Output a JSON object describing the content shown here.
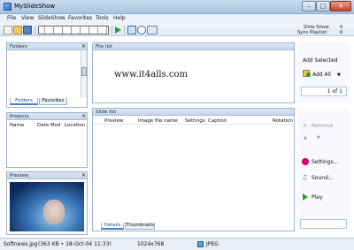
{
  "window": {
    "title": "MySlideShow"
  },
  "menu": [
    "File",
    "View",
    "SlideShow",
    "Favorites",
    "Tools",
    "Help"
  ],
  "toolbar_status": {
    "slide_show_label": "Slide Show:",
    "slide_show_value": "0",
    "sync_playlist_label": "Sync Playlist:",
    "sync_playlist_value": "0"
  },
  "folders": {
    "title": "Folders",
    "tabs": [
      "Folders",
      "Favorites"
    ]
  },
  "projects": {
    "title": "Projects",
    "columns": [
      "Name",
      "Date Mod",
      "Location"
    ]
  },
  "preview": {
    "title": "Preview"
  },
  "file_list": {
    "title": "File list",
    "watermark": "www.it4alls.com"
  },
  "add_panel": {
    "heading": "Add Selected",
    "add_all_label": "Add All",
    "page_label": "1 of 1"
  },
  "slide_list": {
    "title": "Slide list",
    "columns": [
      "Preview",
      "Image file name",
      "Settings",
      "Caption",
      "Rotation"
    ],
    "tabs": [
      "Details",
      "Thumbnails"
    ]
  },
  "side_actions": {
    "remove": "Remove",
    "settings": "Settings...",
    "sound": "Sound...",
    "play": "Play"
  },
  "statusbar": {
    "file": "Softnews.jpg",
    "info": "(363 KB • 18-Oct-04 11:33)",
    "dims": "1024x768",
    "format": "JPEG"
  },
  "colors": {
    "title_bar": "#c9dcef",
    "panel_head": "#c5d6ea",
    "accent": "#4a7fc0"
  }
}
